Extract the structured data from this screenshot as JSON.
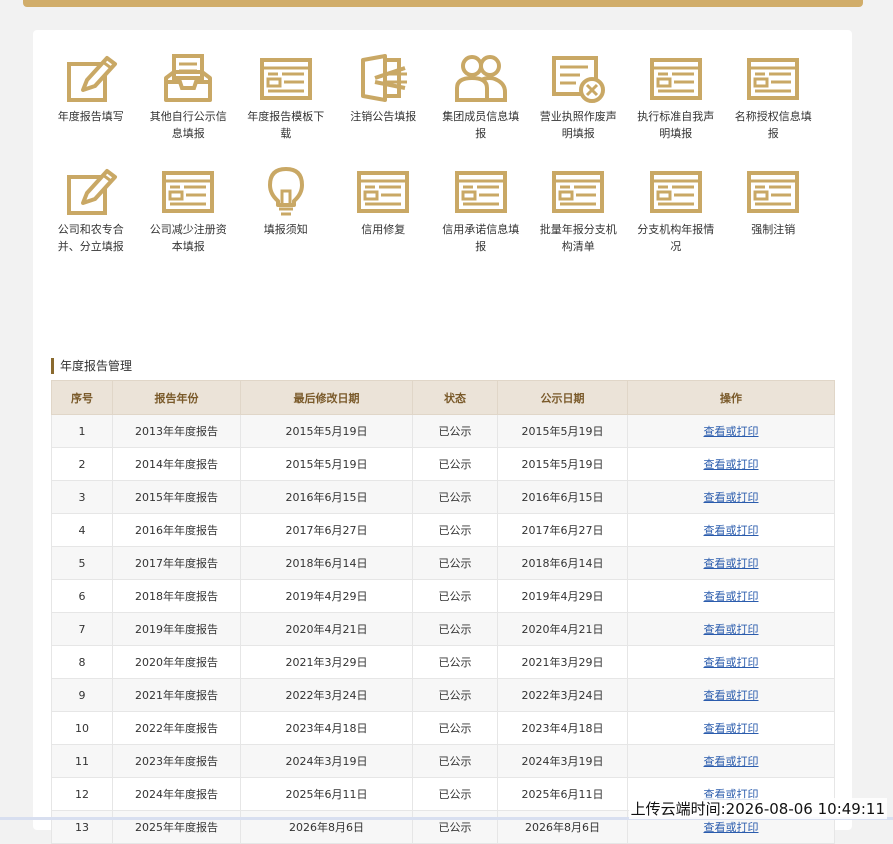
{
  "theme": {
    "accent": "#c9a865",
    "header_bar": "#d1ad6a",
    "link": "#2b5cad",
    "table_head_bg": "#ebe3d8"
  },
  "functions": [
    {
      "label": "年度报告填写",
      "icon": "edit-icon"
    },
    {
      "label": "其他自行公示信息填报",
      "icon": "inbox-tray-icon"
    },
    {
      "label": "年度报告模板下载",
      "icon": "form-template-icon"
    },
    {
      "label": "注销公告填报",
      "icon": "cancel-notice-icon"
    },
    {
      "label": "集团成员信息填报",
      "icon": "group-members-icon"
    },
    {
      "label": "营业执照作废声明填报",
      "icon": "license-void-icon"
    },
    {
      "label": "执行标准自我声明填报",
      "icon": "form-template-icon"
    },
    {
      "label": "名称授权信息填报",
      "icon": "form-template-icon"
    },
    {
      "label": "公司和农专合并、分立填报",
      "icon": "edit-icon"
    },
    {
      "label": "公司减少注册资本填报",
      "icon": "form-template-icon"
    },
    {
      "label": "填报须知",
      "icon": "lightbulb-icon"
    },
    {
      "label": "信用修复",
      "icon": "form-template-icon"
    },
    {
      "label": "信用承诺信息填报",
      "icon": "form-template-icon"
    },
    {
      "label": "批量年报分支机构清单",
      "icon": "form-template-icon"
    },
    {
      "label": "分支机构年报情况",
      "icon": "form-template-icon"
    },
    {
      "label": "强制注销",
      "icon": "form-template-icon"
    }
  ],
  "report_section": {
    "title": "年度报告管理",
    "columns": [
      "序号",
      "报告年份",
      "最后修改日期",
      "状态",
      "公示日期",
      "操作"
    ],
    "rows": [
      [
        "1",
        "2013年年度报告",
        "2015年5月19日",
        "已公示",
        "2015年5月19日",
        "查看或打印"
      ],
      [
        "2",
        "2014年年度报告",
        "2015年5月19日",
        "已公示",
        "2015年5月19日",
        "查看或打印"
      ],
      [
        "3",
        "2015年年度报告",
        "2016年6月15日",
        "已公示",
        "2016年6月15日",
        "查看或打印"
      ],
      [
        "4",
        "2016年年度报告",
        "2017年6月27日",
        "已公示",
        "2017年6月27日",
        "查看或打印"
      ],
      [
        "5",
        "2017年年度报告",
        "2018年6月14日",
        "已公示",
        "2018年6月14日",
        "查看或打印"
      ],
      [
        "6",
        "2018年年度报告",
        "2019年4月29日",
        "已公示",
        "2019年4月29日",
        "查看或打印"
      ],
      [
        "7",
        "2019年年度报告",
        "2020年4月21日",
        "已公示",
        "2020年4月21日",
        "查看或打印"
      ],
      [
        "8",
        "2020年年度报告",
        "2021年3月29日",
        "已公示",
        "2021年3月29日",
        "查看或打印"
      ],
      [
        "9",
        "2021年年度报告",
        "2022年3月24日",
        "已公示",
        "2022年3月24日",
        "查看或打印"
      ],
      [
        "10",
        "2022年年度报告",
        "2023年4月18日",
        "已公示",
        "2023年4月18日",
        "查看或打印"
      ],
      [
        "11",
        "2023年年度报告",
        "2024年3月19日",
        "已公示",
        "2024年3月19日",
        "查看或打印"
      ],
      [
        "12",
        "2024年年度报告",
        "2025年6月11日",
        "已公示",
        "2025年6月11日",
        "查看或打印"
      ],
      [
        "13",
        "2025年年度报告",
        "2026年8月6日",
        "已公示",
        "2026年8月6日",
        "查看或打印"
      ]
    ]
  },
  "overlay": {
    "upload_time": "上传云端时间:2026-08-06 10:49:11"
  }
}
